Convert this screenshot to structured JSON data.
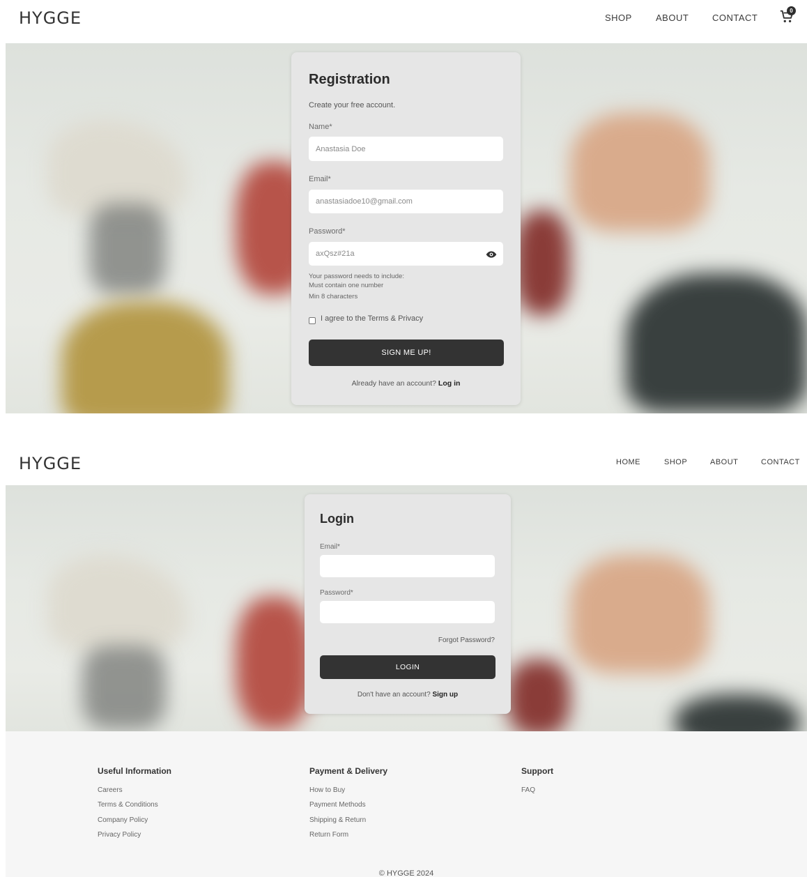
{
  "registration_page": {
    "header": {
      "logo": "HYGGE",
      "nav": [
        "SHOP",
        "ABOUT",
        "CONTACT"
      ],
      "cart_count": "0"
    },
    "form": {
      "title": "Registration",
      "subtitle": "Create your free account.",
      "name_label": "Name*",
      "name_value": "Anastasia Doe",
      "email_label": "Email*",
      "email_value": "anastasiadoe10@gmail.com",
      "password_label": "Password*",
      "password_value": "axQsz#21a",
      "password_hint_title": "Your password needs to include:",
      "password_hints": [
        "Must contain one number",
        "Min 8 characters"
      ],
      "terms_label": "I agree to the Terms & Privacy",
      "terms_checked": false,
      "submit_label": "SIGN ME UP!",
      "alt_prompt": "Already have an account?",
      "alt_link": "Log in"
    }
  },
  "login_page": {
    "header": {
      "logo": "HYGGE",
      "nav": [
        "HOME",
        "SHOP",
        "ABOUT",
        "CONTACT"
      ]
    },
    "form": {
      "title": "Login",
      "email_label": "Email*",
      "email_value": "",
      "password_label": "Password*",
      "password_value": "",
      "forgot_label": "Forgot Password?",
      "submit_label": "LOGIN",
      "alt_prompt": "Don't have an account?",
      "alt_link": "Sign up"
    }
  },
  "footer": {
    "columns": [
      {
        "heading": "Useful Information",
        "links": [
          "Careers",
          "Terms & Conditions",
          "Company Policy",
          "Privacy Policy"
        ]
      },
      {
        "heading": "Payment & Delivery",
        "links": [
          "How to Buy",
          "Payment Methods",
          "Shipping & Return",
          "Return Form"
        ]
      },
      {
        "heading": "Support",
        "links": [
          "FAQ"
        ]
      }
    ],
    "copyright": "© HYGGE 2024"
  },
  "colors": {
    "button": "#333333",
    "card": "#e6e6e6",
    "footer_bg": "#f6f6f6"
  }
}
